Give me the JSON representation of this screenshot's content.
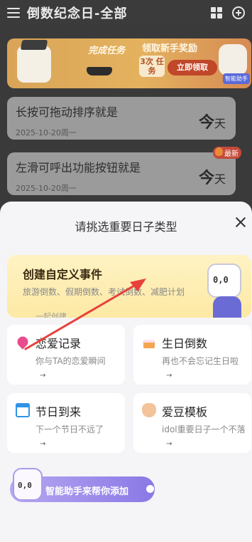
{
  "header": {
    "title": "倒数纪念日-全部"
  },
  "banner": {
    "text_task": "完成任务",
    "text_reward": "领取新手奖励",
    "badge": "3次 任务",
    "button": "立即领取",
    "tag": "智能助手"
  },
  "events": [
    {
      "name": "长按可拖动排序就是",
      "date": "2025-10-20周一",
      "count": "今",
      "unit": "天"
    },
    {
      "name": "左滑可呼出功能按钮就是",
      "date": "2025-10-20周一",
      "count": "今",
      "unit": "天"
    }
  ],
  "new_badge": "最新",
  "sheet": {
    "title": "请挑选重要日子类型",
    "custom": {
      "title": "创建自定义事件",
      "desc": "旅游倒数、假期倒数、考试倒数、减肥计划",
      "cta": "一起创建"
    },
    "types": [
      {
        "title": "恋爱记录",
        "desc": "你与TA的恋爱瞬间",
        "arrow": "→",
        "icon": "heart-icon",
        "color": "#e94c8c"
      },
      {
        "title": "生日倒数",
        "desc": "再也不会忘记生日啦",
        "arrow": "→",
        "icon": "cake-icon",
        "color": "#f2a650"
      },
      {
        "title": "节日到来",
        "desc": "下一个节日不远了",
        "arrow": "→",
        "icon": "calendar-icon",
        "color": "#2f93e6"
      },
      {
        "title": "爱豆模板",
        "desc": "idol重要日子一个不落",
        "arrow": "→",
        "icon": "hand-icon",
        "color": "#f3c39a"
      }
    ],
    "assistant": "智能助手来帮你添加"
  },
  "mascot_face": "0,0",
  "annotation_arrow_color": "#e8413c"
}
